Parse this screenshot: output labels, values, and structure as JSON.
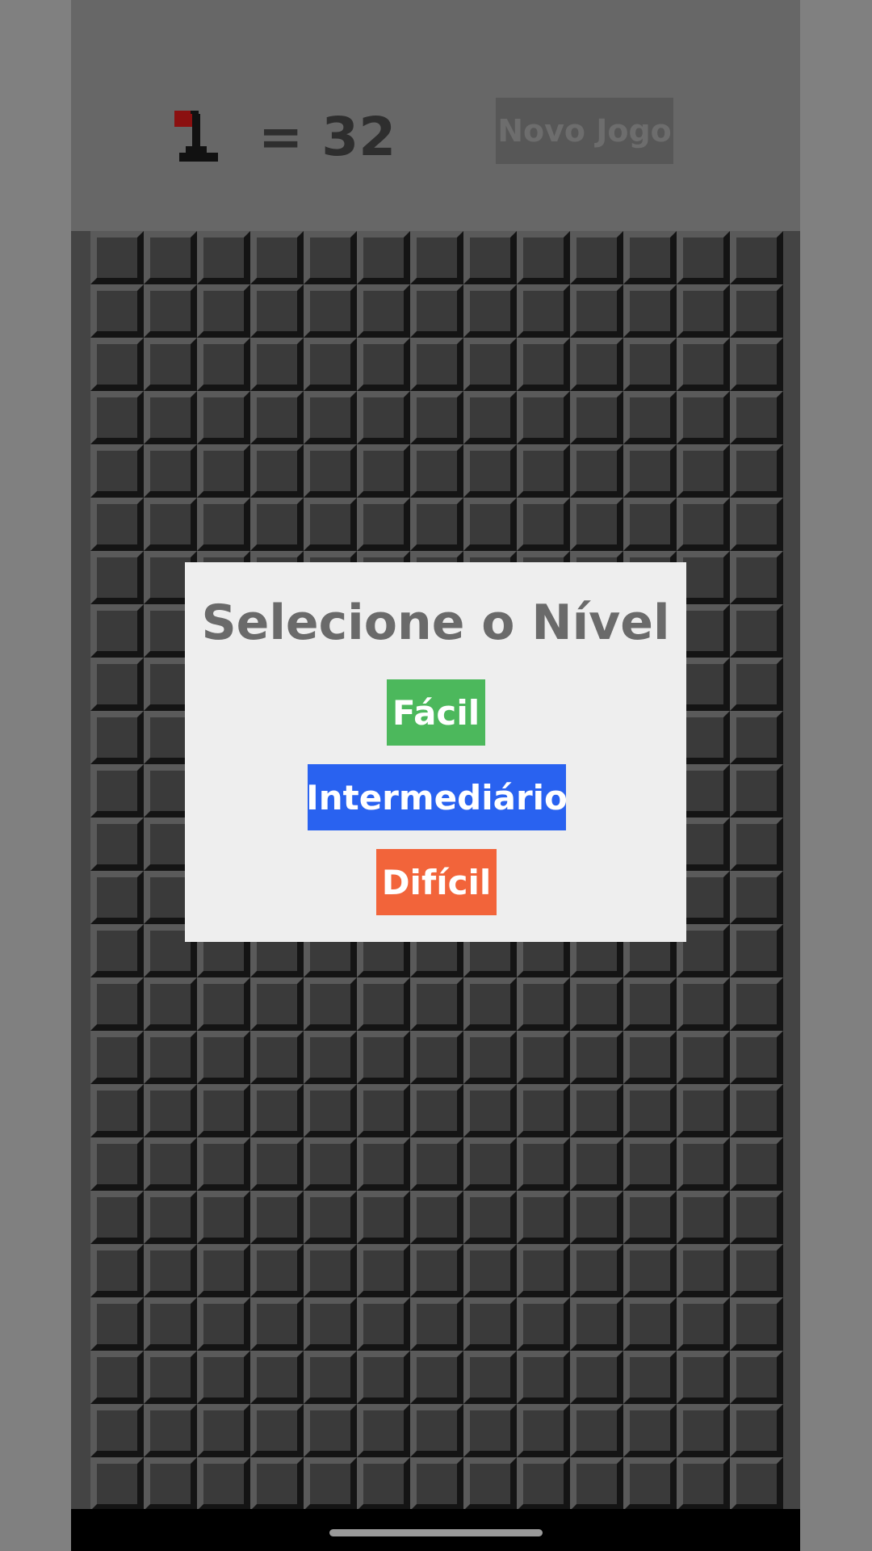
{
  "header": {
    "flag_icon": "flag-icon",
    "flag_count_text": "= 32",
    "new_game_label": "Novo Jogo"
  },
  "board": {
    "columns": 13,
    "rows": 24
  },
  "dialog": {
    "title": "Selecione o Nível",
    "levels": [
      {
        "label": "Fácil",
        "color": "#4cb85c"
      },
      {
        "label": "Intermediário",
        "color": "#2962f0"
      },
      {
        "label": "Difícil",
        "color": "#f2643a"
      }
    ]
  },
  "colors": {
    "background": "#808080",
    "panel": "#676767",
    "board": "#444444",
    "cell": "#3a3a3a",
    "dialog": "#eeeeee",
    "flag": "#8b1010"
  }
}
